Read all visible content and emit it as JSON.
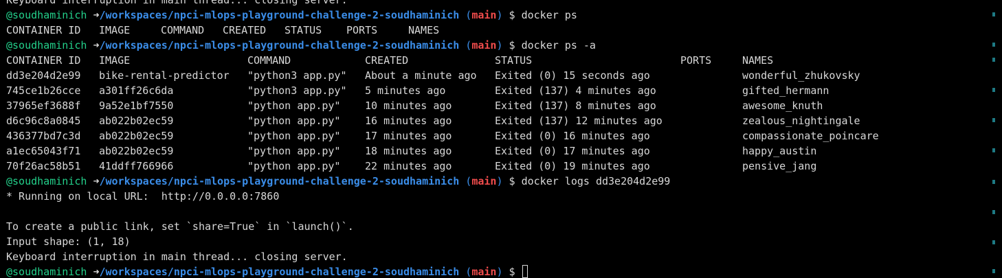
{
  "prompt": {
    "user": "@soudhaminich",
    "arrow": "➜",
    "path": "/workspaces/npci-mlops-playground-challenge-2-soudhaminich",
    "branch_open": "(",
    "branch": "main",
    "branch_close": ")",
    "dollar": "$"
  },
  "top_partial_line": "Keyboard interruption in main thread... closing server.",
  "cmd1": "docker ps",
  "ps_headers": [
    "CONTAINER ID",
    "IMAGE",
    "COMMAND",
    "CREATED",
    "STATUS",
    "PORTS",
    "NAMES"
  ],
  "cmd2": "docker ps -a",
  "psa_headers": [
    "CONTAINER ID",
    "IMAGE",
    "COMMAND",
    "CREATED",
    "STATUS",
    "PORTS",
    "NAMES"
  ],
  "containers": [
    {
      "id": "dd3e204d2e99",
      "image": "bike-rental-predictor",
      "command": "\"python3 app.py\"",
      "created": "About a minute ago",
      "status": "Exited (0) 15 seconds ago",
      "ports": "",
      "names": "wonderful_zhukovsky"
    },
    {
      "id": "745ce1b26cce",
      "image": "a301ff26c6da",
      "command": "\"python3 app.py\"",
      "created": "5 minutes ago",
      "status": "Exited (137) 4 minutes ago",
      "ports": "",
      "names": "gifted_hermann"
    },
    {
      "id": "37965ef3688f",
      "image": "9a52e1bf7550",
      "command": "\"python app.py\"",
      "created": "10 minutes ago",
      "status": "Exited (137) 8 minutes ago",
      "ports": "",
      "names": "awesome_knuth"
    },
    {
      "id": "d6c96c8a0845",
      "image": "ab022b02ec59",
      "command": "\"python app.py\"",
      "created": "16 minutes ago",
      "status": "Exited (137) 12 minutes ago",
      "ports": "",
      "names": "zealous_nightingale"
    },
    {
      "id": "436377bd7c3d",
      "image": "ab022b02ec59",
      "command": "\"python app.py\"",
      "created": "17 minutes ago",
      "status": "Exited (0) 16 minutes ago",
      "ports": "",
      "names": "compassionate_poincare"
    },
    {
      "id": "a1ec65043f71",
      "image": "ab022b02ec59",
      "command": "\"python app.py\"",
      "created": "18 minutes ago",
      "status": "Exited (0) 17 minutes ago",
      "ports": "",
      "names": "happy_austin"
    },
    {
      "id": "70f26ac58b51",
      "image": "41ddff766966",
      "command": "\"python app.py\"",
      "created": "22 minutes ago",
      "status": "Exited (0) 19 minutes ago",
      "ports": "",
      "names": "pensive_jang"
    }
  ],
  "cmd3": "docker logs dd3e204d2e99",
  "logs": [
    "* Running on local URL:  http://0.0.0.0:7860",
    "",
    "To create a public link, set `share=True` in `launch()`.",
    "Input shape: (1, 18)",
    "Keyboard interruption in main thread... closing server."
  ],
  "colors": {
    "background": "#000000",
    "foreground": "#d8d8d8",
    "user": "#23d18b",
    "path": "#3b8eea",
    "branch": "#f14c4c",
    "overview_ruler": "#1e7a84"
  }
}
